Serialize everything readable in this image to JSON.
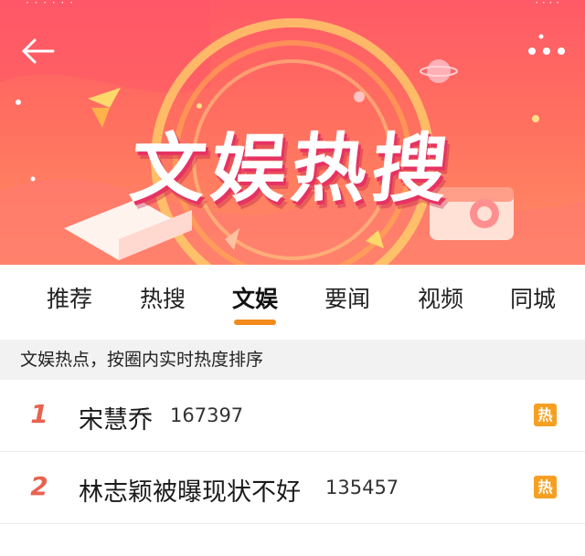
{
  "colors": {
    "accent": "#f28a1c",
    "rank": "#e8634f",
    "hot_badge": "#f5a023",
    "banner_top": "#ff5a67",
    "banner_bottom": "#ff8e64"
  },
  "header": {
    "back_icon": "back-arrow-icon",
    "more_icon": "more-dots-icon",
    "banner_title": "文娱热搜"
  },
  "tabs": [
    {
      "label": "推荐",
      "active": false
    },
    {
      "label": "热搜",
      "active": false
    },
    {
      "label": "文娱",
      "active": true
    },
    {
      "label": "要闻",
      "active": false
    },
    {
      "label": "视频",
      "active": false
    },
    {
      "label": "同城",
      "active": false
    }
  ],
  "section": {
    "description": "文娱热点，按圈内实时热度排序"
  },
  "list": [
    {
      "rank": "1",
      "title": "宋慧乔",
      "count": "167397",
      "badge": "热"
    },
    {
      "rank": "2",
      "title": "林志颖被曝现状不好",
      "count": "135457",
      "badge": "热"
    }
  ]
}
